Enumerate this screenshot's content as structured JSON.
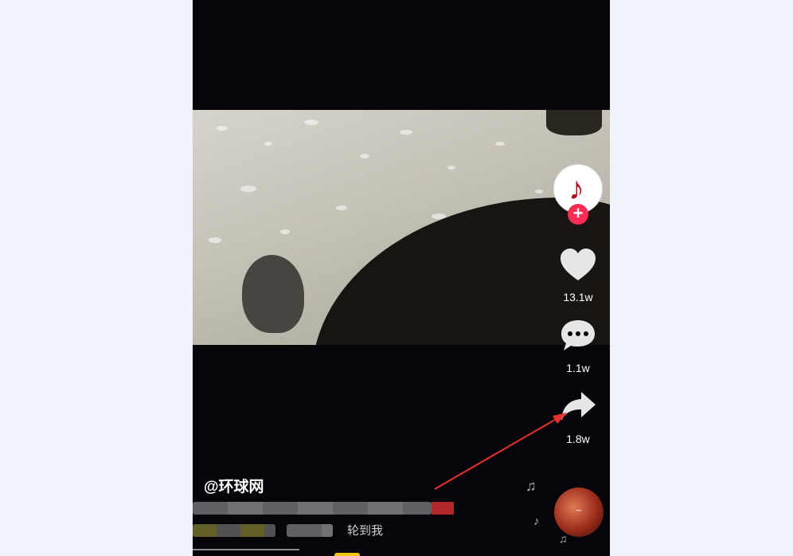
{
  "author": {
    "handle": "@环球网"
  },
  "actions": {
    "like": {
      "count": "13.1w",
      "icon": "heart-icon"
    },
    "comment": {
      "count": "1.1w",
      "icon": "comment-icon"
    },
    "share": {
      "count": "1.8w",
      "icon": "share-icon"
    }
  },
  "caption": {
    "visible_fragment": "轮到我"
  },
  "colors": {
    "follow_accent": "#fe2c55",
    "annotation_arrow": "#e8302c",
    "progress_knob": "#f5c518"
  }
}
